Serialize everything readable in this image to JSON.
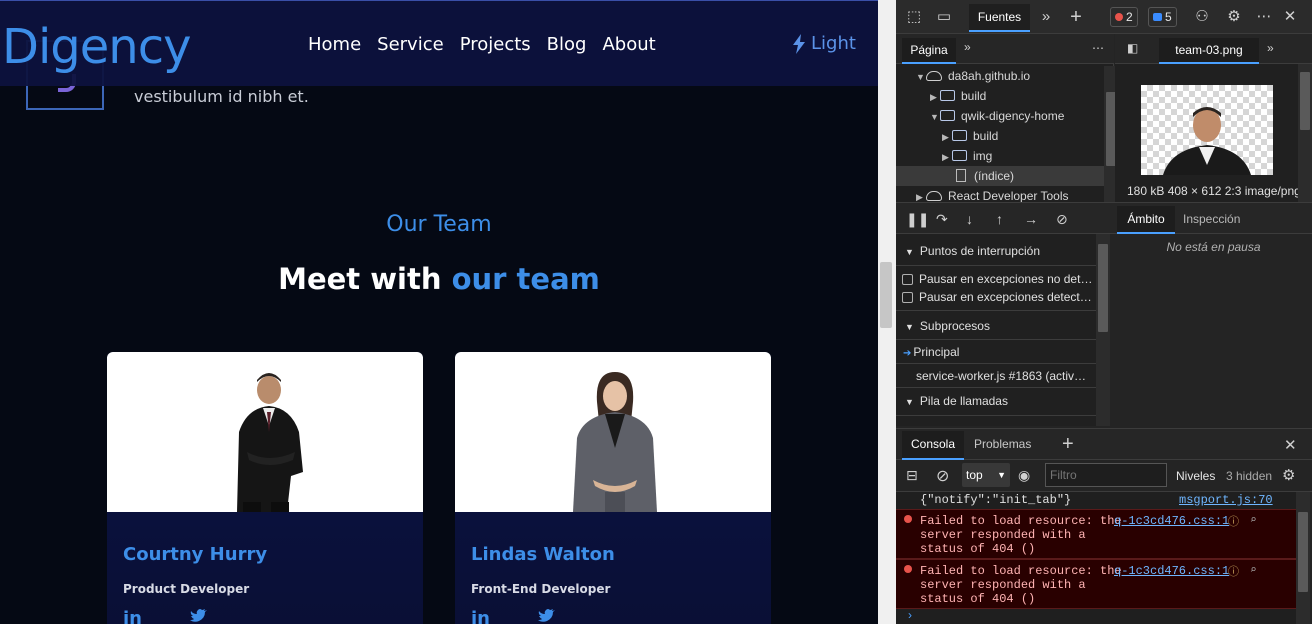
{
  "site": {
    "logo": "Digency",
    "nav": [
      "Home",
      "Service",
      "Projects",
      "Blog",
      "About"
    ],
    "theme_toggle": "Light",
    "behind_text": "vestibulum id nibh et.",
    "section_kicker": "Our Team",
    "section_title_plain": "Meet with ",
    "section_title_accent": "our team",
    "cards": [
      {
        "name": "Courtny Hurry",
        "role": "Product Developer",
        "social1": "in",
        "social2": "twitter-icon"
      },
      {
        "name": "Lindas Walton",
        "role": "Front-End Developer",
        "social1": "in",
        "social2": "twitter-icon"
      }
    ]
  },
  "devtools": {
    "main_tab": "Fuentes",
    "error_count": "2",
    "info_count": "5",
    "sources_tab": "Página",
    "tree": [
      "da8ah.github.io",
      "build",
      "qwik-digency-home",
      "build",
      "img",
      "(índice)",
      "React Developer Tools"
    ],
    "preview_tab": "team-03.png",
    "preview_meta": "180 kB  408 × 612  2:3  image/png",
    "scope_tab": "Ámbito",
    "watch_tab": "Inspección",
    "not_paused": "No está en pausa",
    "breakpoints_header": "Puntos de interrupción",
    "pause_uncaught": "Pausar en excepciones no det…",
    "pause_caught": "Pausar en excepciones detect…",
    "threads_header": "Subprocesos",
    "thread_main": "Principal",
    "thread_sw": "service-worker.js #1863 (activ…",
    "callstack_header": "Pila de llamadas",
    "console_tab": "Consola",
    "problems_tab": "Problemas",
    "context": "top",
    "filter_placeholder": "Filtro",
    "levels": "Niveles",
    "hidden": "3 hidden",
    "messages": [
      {
        "type": "info",
        "text": "{\"notify\":\"init_tab\"}",
        "source": "msgport.js:70"
      },
      {
        "type": "error",
        "lines": [
          "Failed to load resource: the",
          "server responded with a",
          "status of 404 ()"
        ],
        "source": "q-1c3cd476.css:1"
      },
      {
        "type": "error",
        "lines": [
          "Failed to load resource: the",
          "server responded with a",
          "status of 404 ()"
        ],
        "source": "q-1c3cd476.css:1"
      }
    ]
  },
  "colors": {
    "accent": "#3d8ee8",
    "site_bg": "#050914",
    "devtools_bg": "#242424",
    "error_bg": "#290000"
  }
}
